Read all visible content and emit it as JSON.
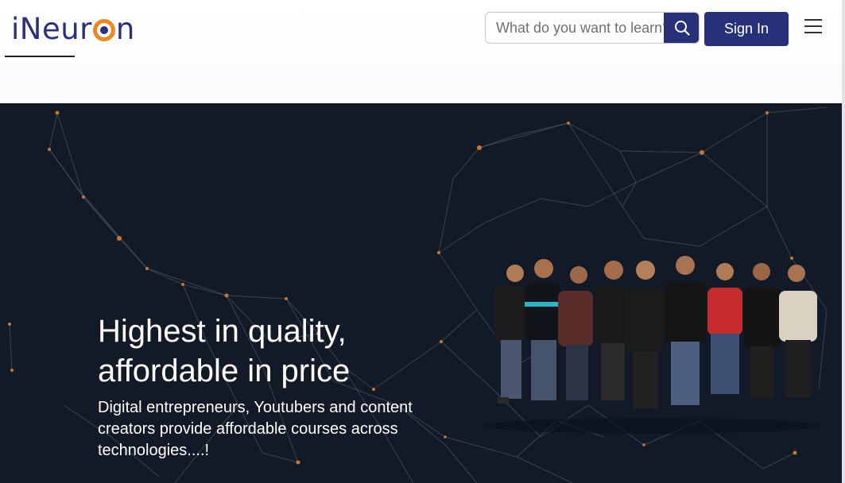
{
  "header": {
    "logo": {
      "text_before": "iNeur",
      "text_after": "n"
    },
    "search": {
      "placeholder": "What do you want to learn?",
      "icon": "search-icon"
    },
    "signin_label": "Sign In",
    "menu_icon": "hamburger-menu-icon"
  },
  "hero": {
    "heading_line1": "Highest in quality,",
    "heading_line2": "affordable in price",
    "subtext": "Digital entrepreneurs, Youtubers and content creators provide affordable courses across technologies....!",
    "image": "team-photo"
  },
  "colors": {
    "brand_navy": "#26317a",
    "logo_orange": "#f2861e",
    "hero_bg": "#121a28",
    "network_node": "#c8782c"
  }
}
